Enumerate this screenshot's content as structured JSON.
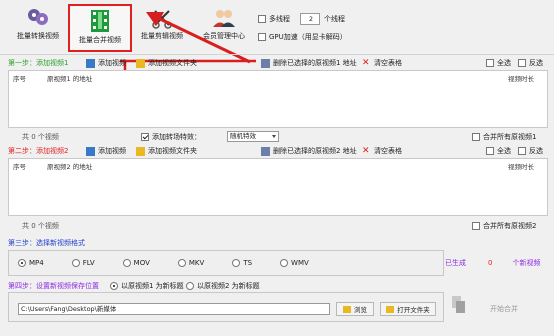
{
  "toolbar": {
    "items": [
      {
        "label": "批量转换视频",
        "icon": "film-reels-icon"
      },
      {
        "label": "批量合并视频",
        "icon": "merge-film-icon"
      },
      {
        "label": "批量剪辑视频",
        "icon": "scissors-icon"
      },
      {
        "label": "会员管理中心",
        "icon": "members-icon"
      }
    ],
    "multithread_label": "多线程",
    "thread_count": "2",
    "thread_unit": "个线程",
    "gpu_label": "GPU加速（用显卡解码）"
  },
  "step1": {
    "label": "第一步：",
    "action": "添加视频1",
    "add_video": "添加视频",
    "add_folder": "添加视频文件夹",
    "delete_selected": "删除已选择的原视频1 地址",
    "clear_table": "清空表格",
    "select_all": "全选",
    "invert": "反选",
    "col_index": "序号",
    "col_path": "原视频1 的地址",
    "col_duration": "视频时长",
    "count": "共 0 个视频",
    "merge_all": "合并所有原视频1"
  },
  "transition": {
    "label": "添加转场特效：",
    "value": "随机特效"
  },
  "step2": {
    "label": "第二步：",
    "action": "添加视频2",
    "add_video": "添加视频",
    "add_folder": "添加视频文件夹",
    "delete_selected": "删除已选择的原视频2 地址",
    "clear_table": "清空表格",
    "select_all": "全选",
    "invert": "反选",
    "col_index": "序号",
    "col_path": "原视频2 的地址",
    "col_duration": "视频时长",
    "count": "共 0 个视频",
    "merge_all": "合并所有原视频2"
  },
  "step3": {
    "label": "第三步：选择新视频格式",
    "formats": [
      "MP4",
      "FLV",
      "MOV",
      "MKV",
      "TS",
      "WMV"
    ],
    "selected": "MP4",
    "generated_prefix": "已生成",
    "generated_count": "0",
    "generated_suffix": "个新视频"
  },
  "step4": {
    "label": "第四步：",
    "action": "设置新视频保存位置",
    "name_option1": "以原视频1 为新标题",
    "name_option2": "以原视频2 为新标题",
    "path": "C:\\Users\\Fang\\Desktop\\新媒体",
    "browse": "浏览",
    "open_folder": "打开文件夹",
    "start": "开始合并"
  },
  "colors": {
    "accent_red": "#e02020",
    "step_blue": "#1f3fd0",
    "action_green": "#2aa02a",
    "purple": "#8a2be2"
  }
}
